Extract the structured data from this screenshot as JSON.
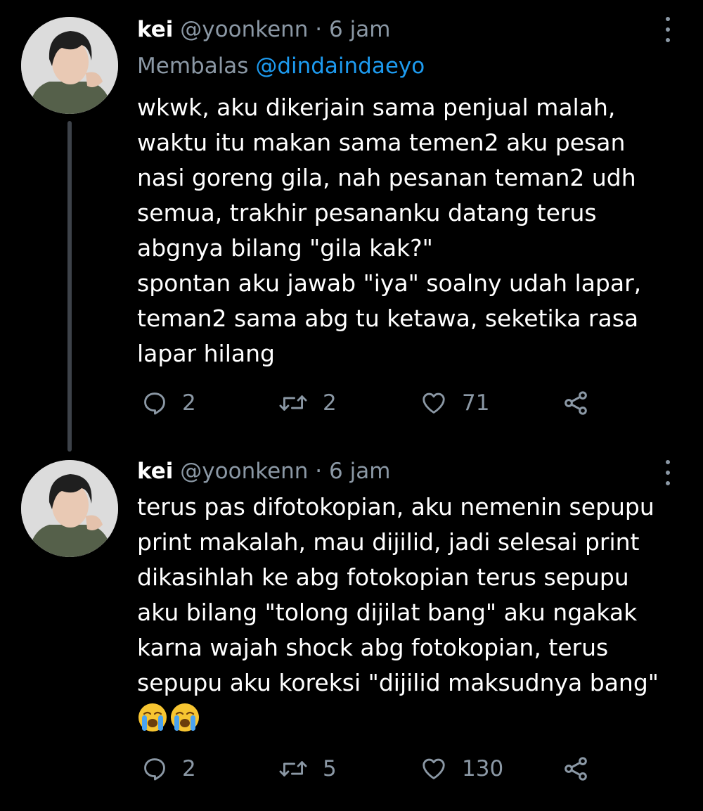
{
  "tweets": [
    {
      "author_name": "kei",
      "author_handle": "@yoonkenn",
      "separator": "·",
      "time": "6 jam",
      "replying_prefix": "Membalas",
      "replying_to": "@dindaindaeyo",
      "text_lines": [
        "wkwk, aku dikerjain sama penjual malah,",
        "waktu itu makan sama temen2 aku pesan",
        "nasi goreng gila, nah pesanan teman2 udh",
        "semua, trakhir pesananku datang terus",
        "abgnya bilang \"gila kak?\"",
        "spontan aku jawab \"iya\" soalny udah lapar,",
        "teman2 sama abg tu ketawa, seketika rasa",
        "lapar hilang"
      ],
      "stats": {
        "replies": "2",
        "retweets": "2",
        "likes": "71"
      },
      "icons": {
        "reply": "reply-icon",
        "retweet": "retweet-icon",
        "like": "heart-icon",
        "share": "share-icon",
        "menu": "more-vertical-icon"
      }
    },
    {
      "author_name": "kei",
      "author_handle": "@yoonkenn",
      "separator": "·",
      "time": "6 jam",
      "text_lines": [
        "terus pas difotokopian, aku nemenin sepupu",
        "print makalah, mau dijilid, jadi selesai print",
        "dikasihlah ke abg fotokopian terus sepupu",
        "aku bilang \"tolong dijilat bang\" aku ngakak",
        "karna wajah shock abg fotokopian, terus",
        "sepupu aku koreksi \"dijilid maksudnya bang\""
      ],
      "emojis": [
        "loudly-crying-face",
        "loudly-crying-face"
      ],
      "stats": {
        "replies": "2",
        "retweets": "5",
        "likes": "130"
      },
      "icons": {
        "reply": "reply-icon",
        "retweet": "retweet-icon",
        "like": "heart-icon",
        "share": "share-icon",
        "menu": "more-vertical-icon"
      }
    }
  ],
  "colors": {
    "background": "#000000",
    "text": "#ffffff",
    "secondary": "#8b98a5",
    "link": "#1d9bf0",
    "thread_line": "#3d4249"
  }
}
